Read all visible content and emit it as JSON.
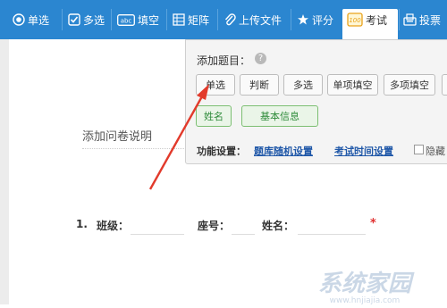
{
  "toolbar": {
    "items": [
      {
        "label": "单选",
        "icon": "radio-icon"
      },
      {
        "label": "多选",
        "icon": "checkbox-icon"
      },
      {
        "label": "填空",
        "icon": "fill-blank-icon"
      },
      {
        "label": "矩阵",
        "icon": "matrix-icon"
      },
      {
        "label": "上传文件",
        "icon": "paperclip-icon"
      },
      {
        "label": "评分",
        "icon": "rating-icon"
      },
      {
        "label": "考试",
        "icon": "exam-icon"
      },
      {
        "label": "投票",
        "icon": "vote-icon"
      }
    ],
    "active": "考试",
    "colors": {
      "bar": "#2b86d0",
      "text": "#ffffff"
    }
  },
  "panel": {
    "title": "添加题目：",
    "help_icon": "?",
    "buttons_row1": [
      "单选",
      "判断",
      "多选",
      "单项填空",
      "多项填空"
    ],
    "buttons_row2": [
      "姓名",
      "基本信息"
    ],
    "func_label": "功能设置：",
    "links": [
      "题库随机设置",
      "考试时间设置"
    ],
    "checkbox_label": "隐藏"
  },
  "form": {
    "description_placeholder": "添加问卷说明",
    "question_number": "1.",
    "fields": [
      "班级：",
      "座号：",
      "姓名："
    ],
    "required_mark": "*"
  },
  "watermark": {
    "text": "系统家园",
    "url": "www.hnjiajia.com"
  },
  "colors": {
    "accent_blue": "#2b86d0",
    "green_button": "#2e8b3a",
    "link": "#1f57a8",
    "arrow_red": "#e23a2b",
    "required": "#e03030"
  }
}
